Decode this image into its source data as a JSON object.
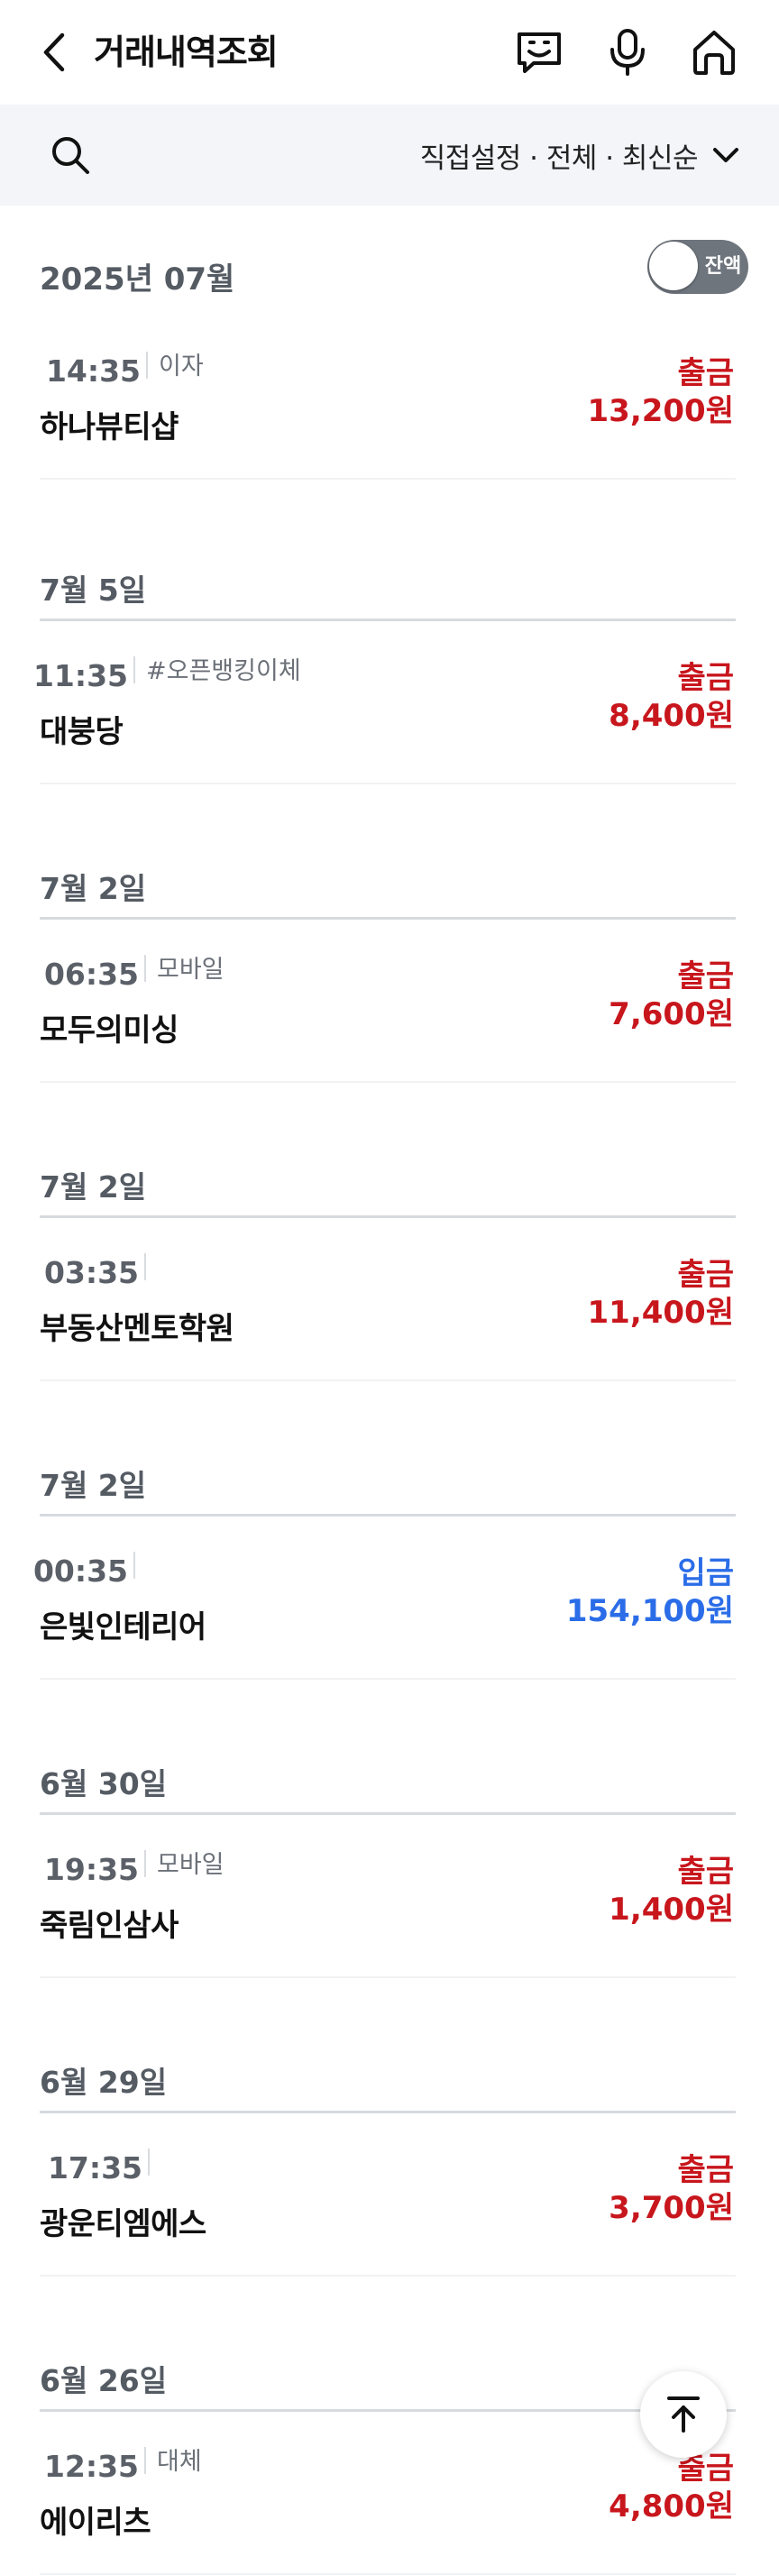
{
  "header": {
    "title": "거래내역조회",
    "icons": [
      "back-arrow-icon",
      "chatbot-icon",
      "microphone-icon",
      "home-icon"
    ]
  },
  "filter": {
    "label": "직접설정 · 전체 · 최신순",
    "icons": [
      "search-icon",
      "chevron-down-icon"
    ]
  },
  "month": {
    "label": "2025년 07월",
    "balance_toggle_label": "잔액",
    "balance_toggle_on": false
  },
  "colors": {
    "withdrawal": "#c8161d",
    "deposit": "#2b6de8",
    "date_text": "#555b63"
  },
  "groups": [
    {
      "date": "",
      "transactions": [
        {
          "time": "14:35",
          "memo": "이자",
          "name": "하나뷰티샵",
          "type": "출금",
          "amount": "13,200원",
          "kind": "out"
        }
      ]
    },
    {
      "date": "7월 5일",
      "transactions": [
        {
          "time": "11:35",
          "memo": "#오픈뱅킹이체",
          "name": "대붕당",
          "type": "출금",
          "amount": "8,400원",
          "kind": "out"
        }
      ]
    },
    {
      "date": "7월 2일",
      "transactions": [
        {
          "time": "06:35",
          "memo": "모바일",
          "name": "모두의미싱",
          "type": "출금",
          "amount": "7,600원",
          "kind": "out"
        }
      ]
    },
    {
      "date": "7월 2일",
      "transactions": [
        {
          "time": "03:35",
          "memo": "",
          "name": "부동산멘토학원",
          "type": "출금",
          "amount": "11,400원",
          "kind": "out"
        }
      ]
    },
    {
      "date": "7월 2일",
      "transactions": [
        {
          "time": "00:35",
          "memo": "",
          "name": "은빛인테리어",
          "type": "입금",
          "amount": "154,100원",
          "kind": "in"
        }
      ]
    },
    {
      "date": "6월 30일",
      "transactions": [
        {
          "time": "19:35",
          "memo": "모바일",
          "name": "죽림인삼사",
          "type": "출금",
          "amount": "1,400원",
          "kind": "out"
        }
      ]
    },
    {
      "date": "6월 29일",
      "transactions": [
        {
          "time": "17:35",
          "memo": "",
          "name": "광운티엠에스",
          "type": "출금",
          "amount": "3,700원",
          "kind": "out"
        }
      ]
    },
    {
      "date": "6월 26일",
      "transactions": [
        {
          "time": "12:35",
          "memo": "대체",
          "name": "에이리츠",
          "type": "출금",
          "amount": "4,800원",
          "kind": "out"
        }
      ]
    }
  ],
  "scroll_top": {
    "icon": "arrow-up-icon"
  }
}
